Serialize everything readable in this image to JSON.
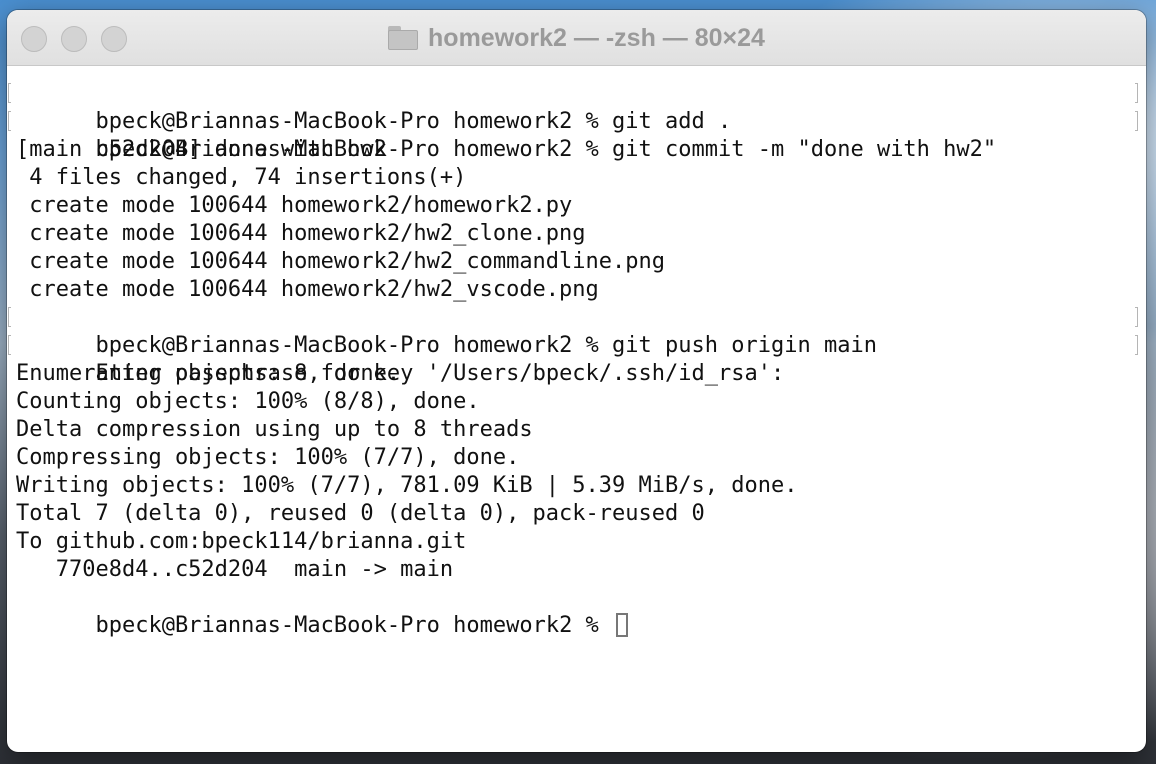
{
  "window": {
    "title": "homework2 — -zsh — 80×24",
    "title_icon": "folder-icon"
  },
  "terminal": {
    "lines": [
      "bpeck@Briannas-MacBook-Pro homework2 % git add .",
      "bpeck@Briannas-MacBook-Pro homework2 % git commit -m \"done with hw2\"",
      "[main c52d204] done with hw2",
      " 4 files changed, 74 insertions(+)",
      " create mode 100644 homework2/homework2.py",
      " create mode 100644 homework2/hw2_clone.png",
      " create mode 100644 homework2/hw2_commandline.png",
      " create mode 100644 homework2/hw2_vscode.png",
      "bpeck@Briannas-MacBook-Pro homework2 % git push origin main",
      "Enter passphrase for key '/Users/bpeck/.ssh/id_rsa':",
      "Enumerating objects: 8, done.",
      "Counting objects: 100% (8/8), done.",
      "Delta compression using up to 8 threads",
      "Compressing objects: 100% (7/7), done.",
      "Writing objects: 100% (7/7), 781.09 KiB | 5.39 MiB/s, done.",
      "Total 7 (delta 0), reused 0 (delta 0), pack-reused 0",
      "To github.com:bpeck114/brianna.git",
      "   770e8d4..c52d204  main -> main"
    ],
    "prompt": "bpeck@Briannas-MacBook-Pro homework2 % "
  },
  "colors": {
    "background": "#ffffff",
    "text": "#111111",
    "titlebar": "#e6e6e6",
    "title_text": "#9a9a9a"
  }
}
